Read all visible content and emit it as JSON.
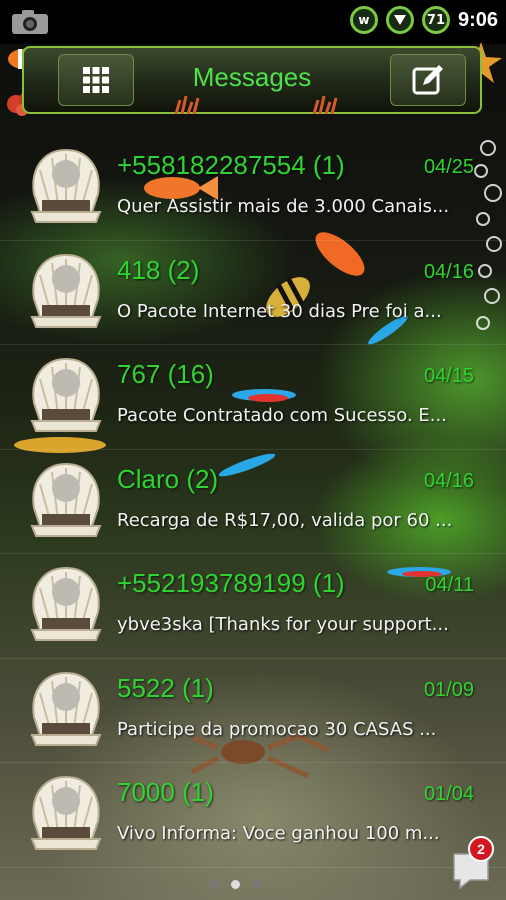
{
  "status_bar": {
    "battery_level": "71",
    "time": "9:06",
    "icons": [
      "screenshot-icon",
      "whatsapp-icon",
      "signal-icon",
      "battery-icon"
    ]
  },
  "header": {
    "title": "Messages",
    "left_button_icon": "grid-menu-icon",
    "right_button_icon": "compose-icon"
  },
  "conversations": [
    {
      "name": "+558182287554 (1)",
      "date": "04/25",
      "snippet": "Quer Assistir mais de 3.000 Canais..."
    },
    {
      "name": "418 (2)",
      "date": "04/16",
      "snippet": "O Pacote Internet 30 dias Pre foi a..."
    },
    {
      "name": "767 (16)",
      "date": "04/15",
      "snippet": "Pacote Contratado com Sucesso. E..."
    },
    {
      "name": "Claro (2)",
      "date": "04/16",
      "snippet": "Recarga de R$17,00, valida por 60 ..."
    },
    {
      "name": "+552193789199 (1)",
      "date": "04/11",
      "snippet": "ybve3ska [Thanks for your support..."
    },
    {
      "name": "5522 (1)",
      "date": "01/09",
      "snippet": "Participe da promocao 30 CASAS ..."
    },
    {
      "name": "7000 (1)",
      "date": "01/04",
      "snippet": "Vivo Informa: Voce ganhou 100 m..."
    }
  ],
  "pager": {
    "count": 3,
    "active": 1
  },
  "notification_badge": "2",
  "colors": {
    "accent_green": "#30d430",
    "title_green": "#4fe04a",
    "badge_red": "#d3161f",
    "header_border": "#8bbf3a"
  }
}
